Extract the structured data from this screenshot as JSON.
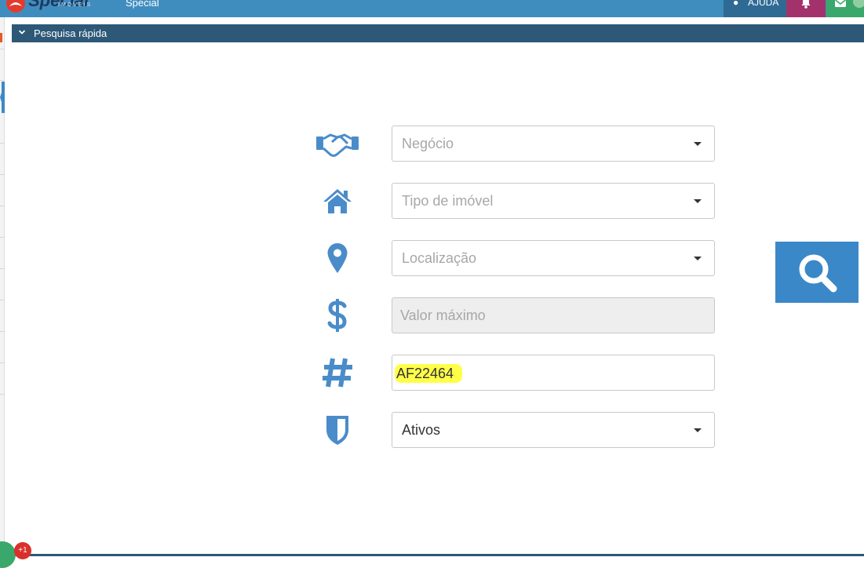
{
  "topbar": {
    "logo_text": "Special",
    "logo_subtext": "IMÓVEIS",
    "brand_label": "Special",
    "help_label": "AJUDA",
    "help_icon": "lightbulb-icon",
    "notifications_icon": "bell-icon",
    "messages_icon": "envelope-icon",
    "colors": {
      "bar": "#3f8dbf",
      "help": "#2f6a94",
      "notifications": "#a3326c",
      "messages": "#3aa86a"
    }
  },
  "panel": {
    "title": "Pesquisa rápida",
    "toggle_icon": "chevron-down-icon",
    "header_color": "#2d5878"
  },
  "search_form": {
    "rows": [
      {
        "icon": "handshake-icon",
        "type": "select",
        "placeholder": "Negócio"
      },
      {
        "icon": "home-icon",
        "type": "select",
        "placeholder": "Tipo de imóvel"
      },
      {
        "icon": "map-marker-icon",
        "type": "select",
        "placeholder": "Localização"
      },
      {
        "icon": "dollar-icon",
        "type": "input-disabled",
        "placeholder": "Valor máximo"
      },
      {
        "icon": "hashtag-icon",
        "type": "input",
        "value": "AF22464"
      },
      {
        "icon": "shield-icon",
        "type": "select",
        "value": "Ativos"
      }
    ],
    "icon_color": "#4a8cc9",
    "highlight_color": "#ffff4a"
  },
  "search_button": {
    "icon": "search-icon",
    "color": "#3b88c8"
  },
  "bottom": {
    "badge_text": "+1"
  }
}
